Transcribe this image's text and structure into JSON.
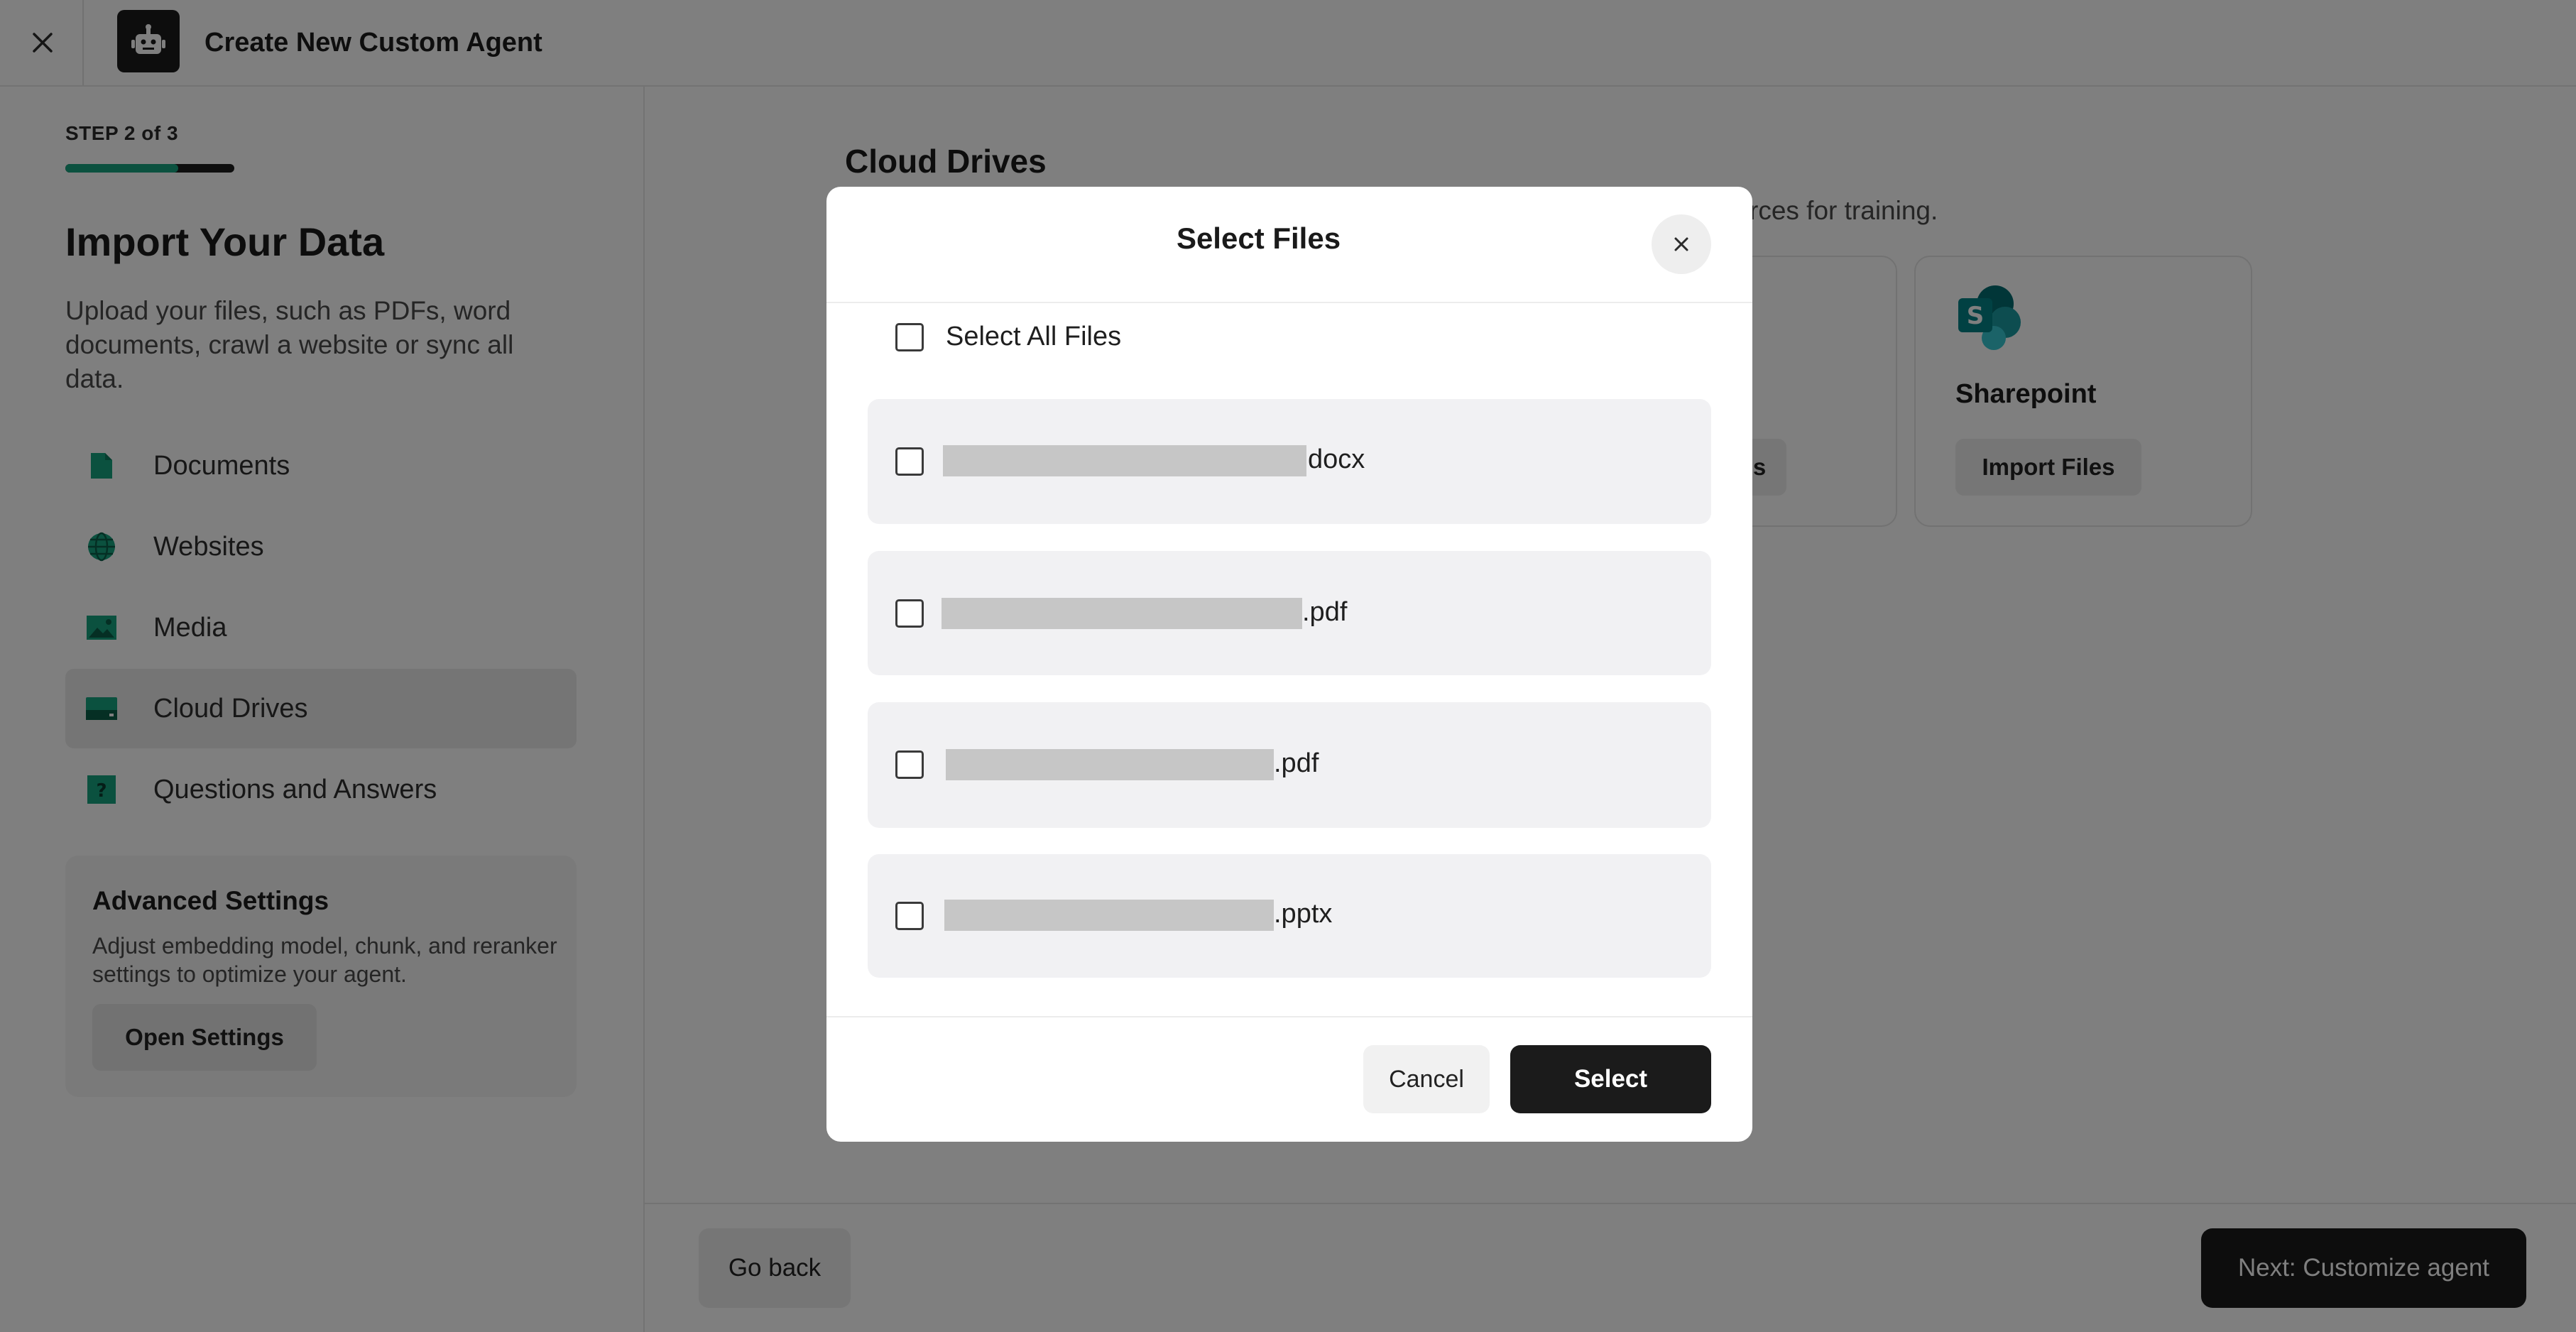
{
  "header": {
    "title": "Create New Custom Agent",
    "close_icon": "close-icon",
    "logo_icon": "robot-icon"
  },
  "sidebar": {
    "step_label": "STEP 2 of 3",
    "progress_fraction": 0.67,
    "progress_color": "#16a37f",
    "title": "Import Your Data",
    "subtitle": "Upload your files, such as PDFs, word documents, crawl a website or sync all data.",
    "items": [
      {
        "label": "Documents",
        "icon": "document-icon",
        "active": false
      },
      {
        "label": "Websites",
        "icon": "globe-icon",
        "active": false
      },
      {
        "label": "Media",
        "icon": "image-icon",
        "active": false
      },
      {
        "label": "Cloud Drives",
        "icon": "drive-icon",
        "active": true
      },
      {
        "label": "Questions and Answers",
        "icon": "question-icon",
        "active": false
      }
    ],
    "advanced": {
      "title": "Advanced Settings",
      "description": "Adjust embedding model, chunk, and reranker settings to optimize your agent.",
      "button_label": "Open Settings"
    }
  },
  "main": {
    "title": "Cloud Drives",
    "description_tail": "rces for training.",
    "cards": [
      {
        "title": "",
        "button_label": "s"
      },
      {
        "title": "Sharepoint",
        "button_label": "Import Files",
        "icon": "sharepoint-icon"
      }
    ],
    "footer": {
      "back_label": "Go back",
      "next_label": "Next: Customize agent"
    }
  },
  "modal": {
    "title": "Select Files",
    "select_all_label": "Select All Files",
    "files": [
      {
        "extension": "docx"
      },
      {
        "extension": ".pdf"
      },
      {
        "extension": ".pdf"
      },
      {
        "extension": ".pptx"
      }
    ],
    "cancel_label": "Cancel",
    "select_label": "Select"
  },
  "colors": {
    "accent_green": "#16a37f",
    "dark_button": "#1b1b1b",
    "sharepoint_teal": "#0b7d7a"
  }
}
